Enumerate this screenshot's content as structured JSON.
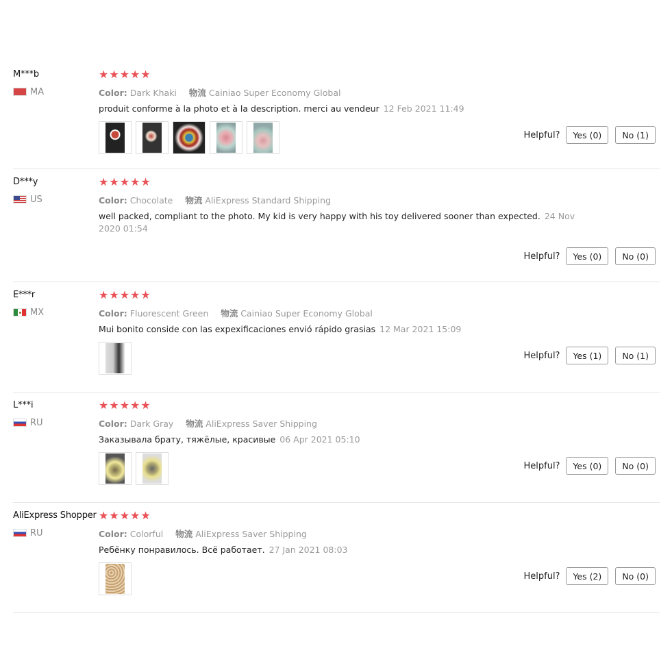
{
  "helpful_label": "Helpful?",
  "reviews": [
    {
      "user": "M***b",
      "country": "MA",
      "stars": "★★★★★",
      "color_label": "Color:",
      "color": "Dark Khaki",
      "shipping_label": "物流",
      "shipping": "Cainiao Super Economy Global",
      "text": "produit conforme à la photo et à la description. merci au vendeur",
      "date": "12 Feb 2021 11:49",
      "yes": "Yes (0)",
      "no": "No (1)"
    },
    {
      "user": "D***y",
      "country": "US",
      "stars": "★★★★★",
      "color_label": "Color:",
      "color": "Chocolate",
      "shipping_label": "物流",
      "shipping": "AliExpress Standard Shipping",
      "text": "well packed, compliant to the photo. My kid is very happy with his toy delivered sooner than expected.",
      "date": "24 Nov 2020 01:54",
      "yes": "Yes (0)",
      "no": "No (0)"
    },
    {
      "user": "E***r",
      "country": "MX",
      "stars": "★★★★★",
      "color_label": "Color:",
      "color": "Fluorescent Green",
      "shipping_label": "物流",
      "shipping": "Cainiao Super Economy Global",
      "text": "Mui bonito conside con las expexificaciones envió rápido grasias",
      "date": "12 Mar 2021 15:09",
      "yes": "Yes (1)",
      "no": "No (1)"
    },
    {
      "user": "L***i",
      "country": "RU",
      "stars": "★★★★★",
      "color_label": "Color:",
      "color": "Dark Gray",
      "shipping_label": "物流",
      "shipping": "AliExpress Saver Shipping",
      "text": "Заказывала брату, тяжёлые, красивые",
      "date": "06 Apr 2021 05:10",
      "yes": "Yes (0)",
      "no": "No (0)"
    },
    {
      "user": "AliExpress Shopper",
      "country": "RU",
      "stars": "★★★★★",
      "color_label": "Color:",
      "color": "Colorful",
      "shipping_label": "物流",
      "shipping": "AliExpress Saver Shipping",
      "text": "Ребёнку понравилось. Всё работает.",
      "date": "27 Jan 2021 08:03",
      "yes": "Yes (2)",
      "no": "No (0)"
    }
  ]
}
